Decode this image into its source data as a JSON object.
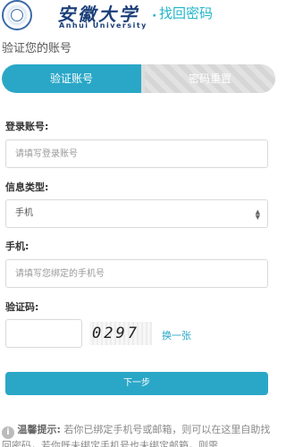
{
  "header": {
    "logo_cn": "安徽大学",
    "logo_en": "Anhui University",
    "separator": "·",
    "title": "找回密码"
  },
  "verify_title": "验证您的账号",
  "steps": [
    {
      "label": "验证账号",
      "active": true
    },
    {
      "label": "密码重置",
      "active": false
    }
  ],
  "form": {
    "account_label": "登录账号:",
    "account_placeholder": "请填写登录账号",
    "info_type_label": "信息类型:",
    "info_type_value": "手机",
    "phone_label": "手机:",
    "phone_placeholder": "请填写您绑定的手机号",
    "captcha_label": "验证码:",
    "captcha_text": "0297",
    "refresh_label": "换一张",
    "next_label": "下一步"
  },
  "tip": {
    "icon": "i",
    "head": "温馨提示:",
    "text": "若你已绑定手机号或邮箱，则可以在这里自助找回密码，若你既未绑定手机号也未绑定邮箱，则需"
  },
  "colors": {
    "accent": "#2aa7c7",
    "brand": "#1b3f78"
  }
}
